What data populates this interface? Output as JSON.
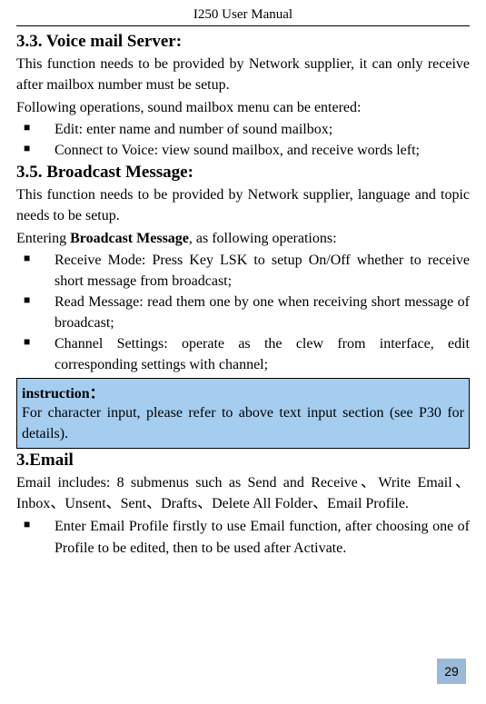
{
  "header": {
    "title": "I250 User Manual"
  },
  "sections": {
    "voicemail": {
      "heading": "3.3. Voice mail Server:",
      "p1": "This function needs to be provided by Network supplier, it can only receive after mailbox number must be setup.",
      "p2": "Following operations, sound mailbox menu can be entered:",
      "items": [
        "Edit: enter name and number of sound mailbox;",
        "Connect to Voice: view sound mailbox, and receive words left;"
      ]
    },
    "broadcast": {
      "heading": "3.5. Broadcast Message:",
      "p1": "This function needs to be provided by Network supplier, language and topic needs to be setup.",
      "entering_prefix": "Entering ",
      "entering_bold": "Broadcast Message",
      "entering_suffix": ", as following operations:",
      "items": [
        "Receive Mode: Press Key LSK to setup On/Off whether to receive short message from broadcast;",
        "Read Message: read them one by one when receiving short message of broadcast;",
        "Channel Settings: operate as the clew from interface, edit corresponding settings with channel;"
      ]
    },
    "instruction": {
      "title": "instruction：",
      "body": "For character input, please refer to above text input section (see P30 for details)."
    },
    "email": {
      "heading": "3.Email",
      "p1": "Email includes: 8 submenus such as Send and Receive、Write Email、Inbox、Unsent、Sent、Drafts、Delete All Folder、Email Profile.",
      "items": [
        "Enter Email Profile firstly to use Email function, after choosing one of Profile to be edited, then to be used after Activate."
      ]
    }
  },
  "page_number": "29"
}
